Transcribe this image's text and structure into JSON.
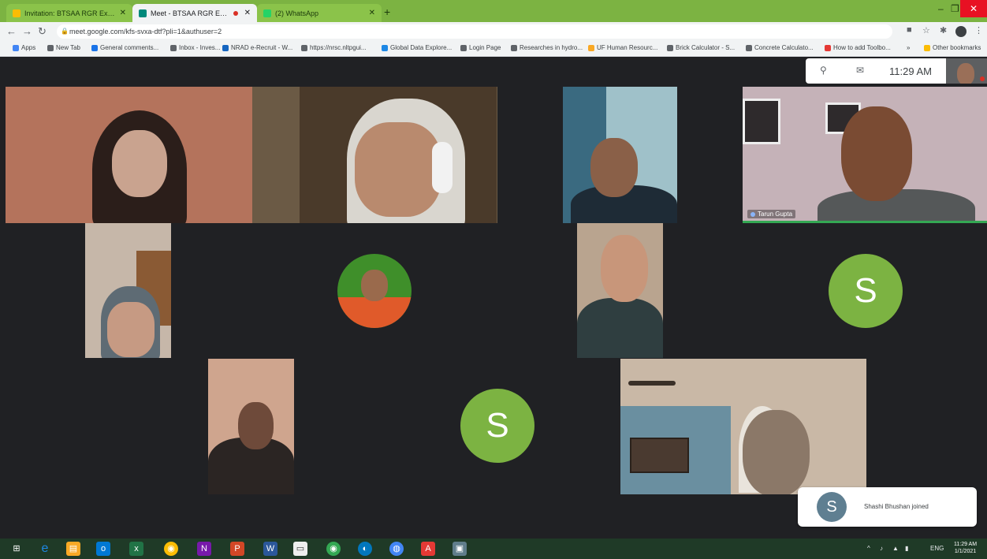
{
  "browser": {
    "tabs": [
      {
        "label": "Invitation: BTSAA RGR Executiv...",
        "active": false,
        "favicon_color": "#fbbc04"
      },
      {
        "label": "Meet - BTSAA RGR Executi...",
        "active": true,
        "favicon_color": "#00897b",
        "recording": true
      },
      {
        "label": "(2) WhatsApp",
        "active": false,
        "favicon_color": "#25d366"
      }
    ],
    "new_tab_label": "+",
    "window_controls": {
      "minimize": "–",
      "maximize": "❐",
      "close": "✕"
    },
    "address": "meet.google.com/kfs-svxa-dtf?pli=1&authuser=2",
    "bookmarks": [
      {
        "label": "Apps",
        "color": "#4285f4"
      },
      {
        "label": "New Tab",
        "color": "#5f6368"
      },
      {
        "label": "General comments...",
        "color": "#1a73e8"
      },
      {
        "label": "Inbox - Inves...",
        "color": "#5f6368"
      },
      {
        "label": "NRAD e-Recruit - W...",
        "color": "#1565c0"
      },
      {
        "label": "https://nrsc.nltpgui...",
        "color": "#5f6368"
      },
      {
        "label": "Global Data Explore...",
        "color": "#1e88e5"
      },
      {
        "label": "Login Page",
        "color": "#5f6368"
      },
      {
        "label": "Researches in hydro...",
        "color": "#5f6368"
      },
      {
        "label": "UF Human Resourc...",
        "color": "#f9a825"
      },
      {
        "label": "Brick Calculator - S...",
        "color": "#5f6368"
      },
      {
        "label": "Concrete Calculato...",
        "color": "#5f6368"
      },
      {
        "label": "How to add Toolbo...",
        "color": "#e53935"
      },
      {
        "label": "»",
        "color": "transparent"
      },
      {
        "label": "Other bookmarks",
        "color": "#fbbc04"
      }
    ]
  },
  "meet": {
    "clock": "11:29 AM",
    "participants": [
      {
        "id": "p1",
        "kind": "video",
        "name": ""
      },
      {
        "id": "p2",
        "kind": "video",
        "name": ""
      },
      {
        "id": "p3",
        "kind": "video",
        "name": ""
      },
      {
        "id": "p4",
        "kind": "video",
        "name": "Tarun Gupta",
        "speaking": true
      },
      {
        "id": "p5",
        "kind": "video",
        "name": ""
      },
      {
        "id": "p6",
        "kind": "avatar-photo",
        "name": ""
      },
      {
        "id": "p7",
        "kind": "video",
        "name": ""
      },
      {
        "id": "p8",
        "kind": "avatar-letter",
        "letter": "S"
      },
      {
        "id": "p9",
        "kind": "video",
        "name": ""
      },
      {
        "id": "p10",
        "kind": "avatar-letter",
        "letter": "S"
      },
      {
        "id": "p11",
        "kind": "video",
        "name": ""
      }
    ],
    "toast": {
      "letter": "S",
      "message": "Shashi Bhushan joined"
    }
  },
  "taskbar": {
    "clock_time": "11:29 AM",
    "clock_date": "1/1/2021",
    "lang": "ENG"
  }
}
